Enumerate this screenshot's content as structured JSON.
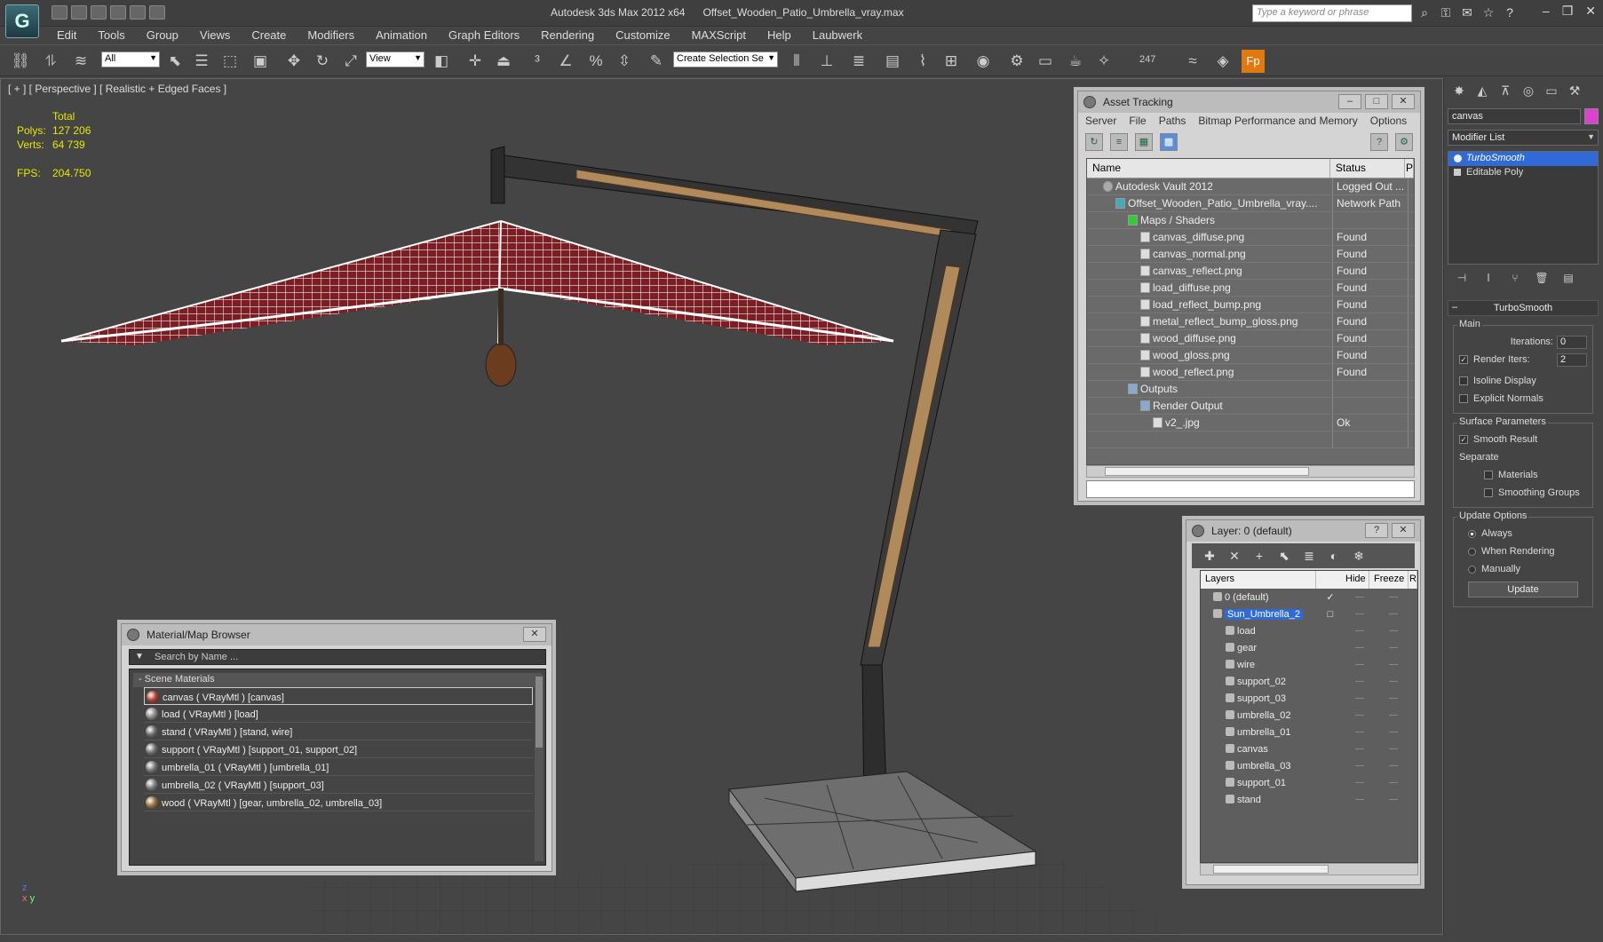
{
  "app": {
    "title": "Autodesk 3ds Max  2012 x64",
    "filename": "Offset_Wooden_Patio_Umbrella_vray.max",
    "search_placeholder": "Type a keyword or phrase"
  },
  "menu": [
    "Edit",
    "Tools",
    "Group",
    "Views",
    "Create",
    "Modifiers",
    "Animation",
    "Graph Editors",
    "Rendering",
    "Customize",
    "MAXScript",
    "Help",
    "Laubwerk"
  ],
  "toolbar": {
    "selection_filter": "All",
    "ref_coord": "View",
    "named_selection": "Create Selection Se",
    "counter": "247"
  },
  "viewport": {
    "label": "[ + ] [ Perspective ] [ Realistic + Edged Faces ]",
    "stats": {
      "total_label": "Total",
      "polys_label": "Polys:",
      "polys": "127 206",
      "verts_label": "Verts:",
      "verts": "64 739",
      "fps_label": "FPS:",
      "fps": "204.750"
    },
    "axis": {
      "z": "z",
      "y": "y",
      "x": "x"
    }
  },
  "asset_tracking": {
    "title": "Asset Tracking",
    "menu": [
      "Server",
      "File",
      "Paths",
      "Bitmap Performance and Memory",
      "Options"
    ],
    "columns": [
      "Name",
      "Status",
      "P"
    ],
    "rows": [
      {
        "name": "Autodesk Vault 2012",
        "status": "Logged Out ...",
        "indent": 1,
        "icon": "vault"
      },
      {
        "name": "Offset_Wooden_Patio_Umbrella_vray....",
        "status": "Network Path",
        "indent": 2,
        "icon": "file"
      },
      {
        "name": "Maps / Shaders",
        "status": "",
        "indent": 3,
        "icon": "folder"
      },
      {
        "name": "canvas_diffuse.png",
        "status": "Found",
        "indent": 4,
        "icon": "img"
      },
      {
        "name": "canvas_normal.png",
        "status": "Found",
        "indent": 4,
        "icon": "img"
      },
      {
        "name": "canvas_reflect.png",
        "status": "Found",
        "indent": 4,
        "icon": "img"
      },
      {
        "name": "load_diffuse.png",
        "status": "Found",
        "indent": 4,
        "icon": "img"
      },
      {
        "name": "load_reflect_bump.png",
        "status": "Found",
        "indent": 4,
        "icon": "img"
      },
      {
        "name": "metal_reflect_bump_gloss.png",
        "status": "Found",
        "indent": 4,
        "icon": "img"
      },
      {
        "name": "wood_diffuse.png",
        "status": "Found",
        "indent": 4,
        "icon": "img"
      },
      {
        "name": "wood_gloss.png",
        "status": "Found",
        "indent": 4,
        "icon": "img"
      },
      {
        "name": "wood_reflect.png",
        "status": "Found",
        "indent": 4,
        "icon": "img"
      },
      {
        "name": "Outputs",
        "status": "",
        "indent": 3,
        "icon": "out"
      },
      {
        "name": "Render Output",
        "status": "",
        "indent": 4,
        "icon": "out"
      },
      {
        "name": "v2_.jpg",
        "status": "Ok",
        "indent": 5,
        "icon": "img"
      },
      {
        "name": "",
        "status": "",
        "indent": 0,
        "icon": "none"
      }
    ]
  },
  "layer_dialog": {
    "title": "Layer: 0 (default)",
    "columns": [
      "Layers",
      "Hide",
      "Freeze",
      "R"
    ],
    "rows": [
      {
        "name": "0 (default)",
        "flag": "✓",
        "indent": 1,
        "selected": false
      },
      {
        "name": "Sun_Umbrella_2",
        "flag": "□",
        "indent": 1,
        "selected": true
      },
      {
        "name": "load",
        "flag": "",
        "indent": 2,
        "selected": false
      },
      {
        "name": "gear",
        "flag": "",
        "indent": 2,
        "selected": false
      },
      {
        "name": "wire",
        "flag": "",
        "indent": 2,
        "selected": false
      },
      {
        "name": "support_02",
        "flag": "",
        "indent": 2,
        "selected": false
      },
      {
        "name": "support_03",
        "flag": "",
        "indent": 2,
        "selected": false
      },
      {
        "name": "umbrella_02",
        "flag": "",
        "indent": 2,
        "selected": false
      },
      {
        "name": "umbrella_01",
        "flag": "",
        "indent": 2,
        "selected": false
      },
      {
        "name": "canvas",
        "flag": "",
        "indent": 2,
        "selected": false
      },
      {
        "name": "umbrella_03",
        "flag": "",
        "indent": 2,
        "selected": false
      },
      {
        "name": "support_01",
        "flag": "",
        "indent": 2,
        "selected": false
      },
      {
        "name": "stand",
        "flag": "",
        "indent": 2,
        "selected": false
      }
    ],
    "cell_mark": "—"
  },
  "material_browser": {
    "title": "Material/Map Browser",
    "search_placeholder": "Search by Name ...",
    "group": "- Scene Materials",
    "items": [
      {
        "label": "canvas  ( VRayMtl ) [canvas]",
        "color": "#b04030"
      },
      {
        "label": "load  ( VRayMtl ) [load]",
        "color": "#8a8a8a"
      },
      {
        "label": "stand  ( VRayMtl ) [stand, wire]",
        "color": "#6a6a6a"
      },
      {
        "label": "support  ( VRayMtl ) [support_01, support_02]",
        "color": "#707070"
      },
      {
        "label": "umbrella_01  ( VRayMtl ) [umbrella_01]",
        "color": "#777777"
      },
      {
        "label": "umbrella_02  ( VRayMtl ) [support_03]",
        "color": "#7a7a7a"
      },
      {
        "label": "wood  ( VRayMtl ) [gear, umbrella_02, umbrella_03]",
        "color": "#9a7040"
      }
    ]
  },
  "command_panel": {
    "object_name": "canvas",
    "object_color": "#e040d0",
    "modifier_list": "Modifier List",
    "stack": [
      {
        "label": "TurboSmooth",
        "selected": true
      },
      {
        "label": "Editable Poly",
        "selected": false
      }
    ],
    "turbosmooth": {
      "title": "TurboSmooth",
      "main_label": "Main",
      "iterations_label": "Iterations:",
      "iterations": "0",
      "render_iters_label": "Render Iters:",
      "render_iters": "2",
      "isoline_label": "Isoline Display",
      "explicit_label": "Explicit Normals",
      "surface_label": "Surface Parameters",
      "smooth_result_label": "Smooth Result",
      "separate_label": "Separate",
      "materials_label": "Materials",
      "smoothing_groups_label": "Smoothing Groups",
      "update_options_label": "Update Options",
      "always_label": "Always",
      "when_rendering_label": "When Rendering",
      "manually_label": "Manually",
      "update_button": "Update"
    }
  }
}
